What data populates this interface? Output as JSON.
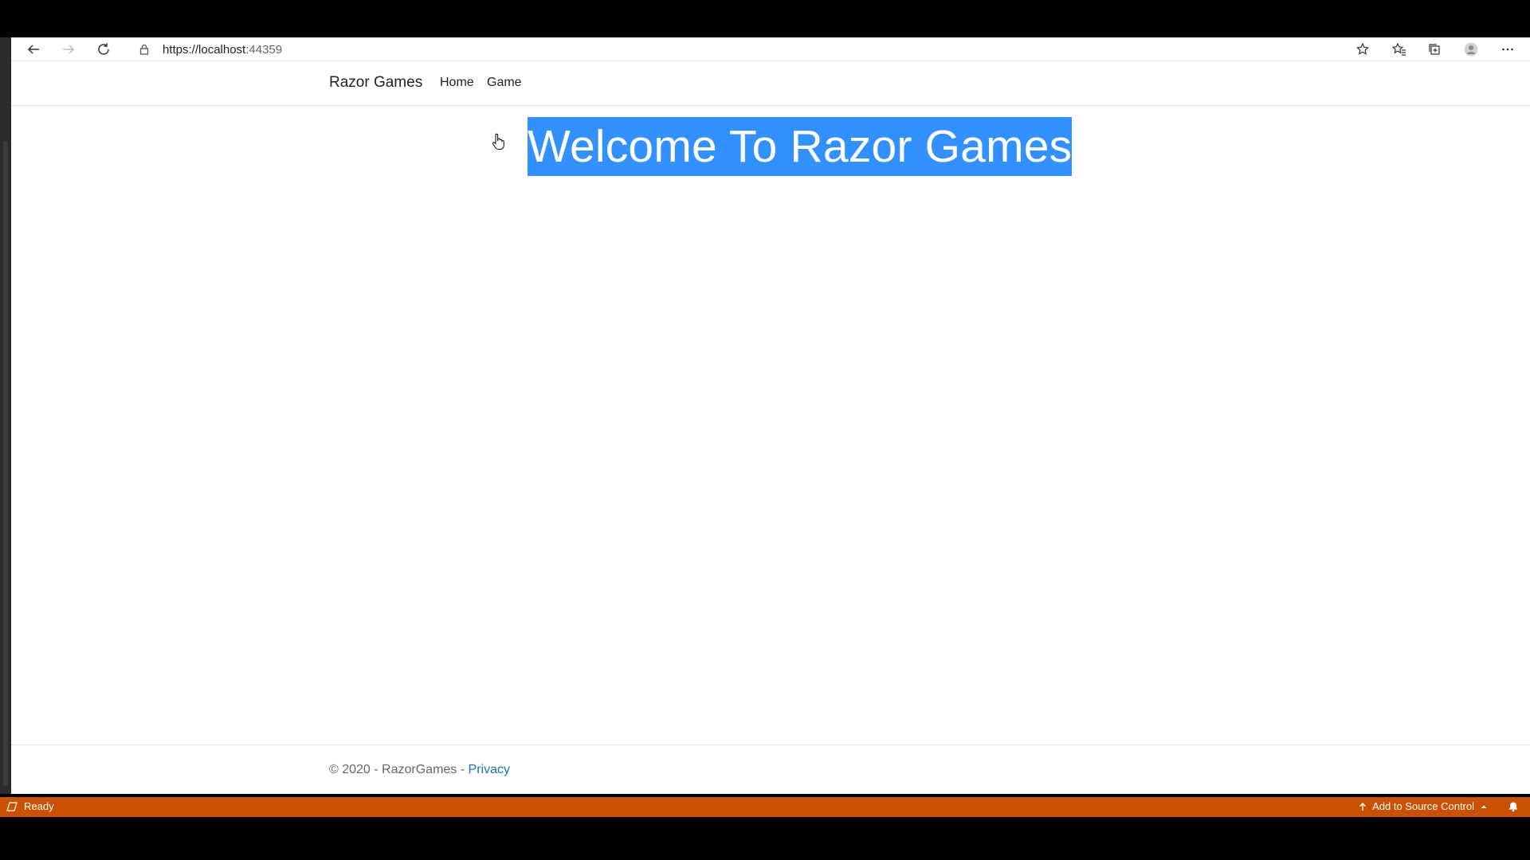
{
  "browser": {
    "url_host": "https://localhost",
    "url_port": ":44359"
  },
  "navbar": {
    "brand": "Razor Games",
    "links": [
      "Home",
      "Game"
    ]
  },
  "main": {
    "heading": "Welcome To Razor Games"
  },
  "footer": {
    "text": "© 2020 - RazorGames - ",
    "privacy_link": "Privacy"
  },
  "statusbar": {
    "status": "Ready",
    "source_control": "Add to Source Control"
  },
  "colors": {
    "status_bar": "#ca5100",
    "selection": "#3390ff",
    "link": "#1a6fb5"
  }
}
